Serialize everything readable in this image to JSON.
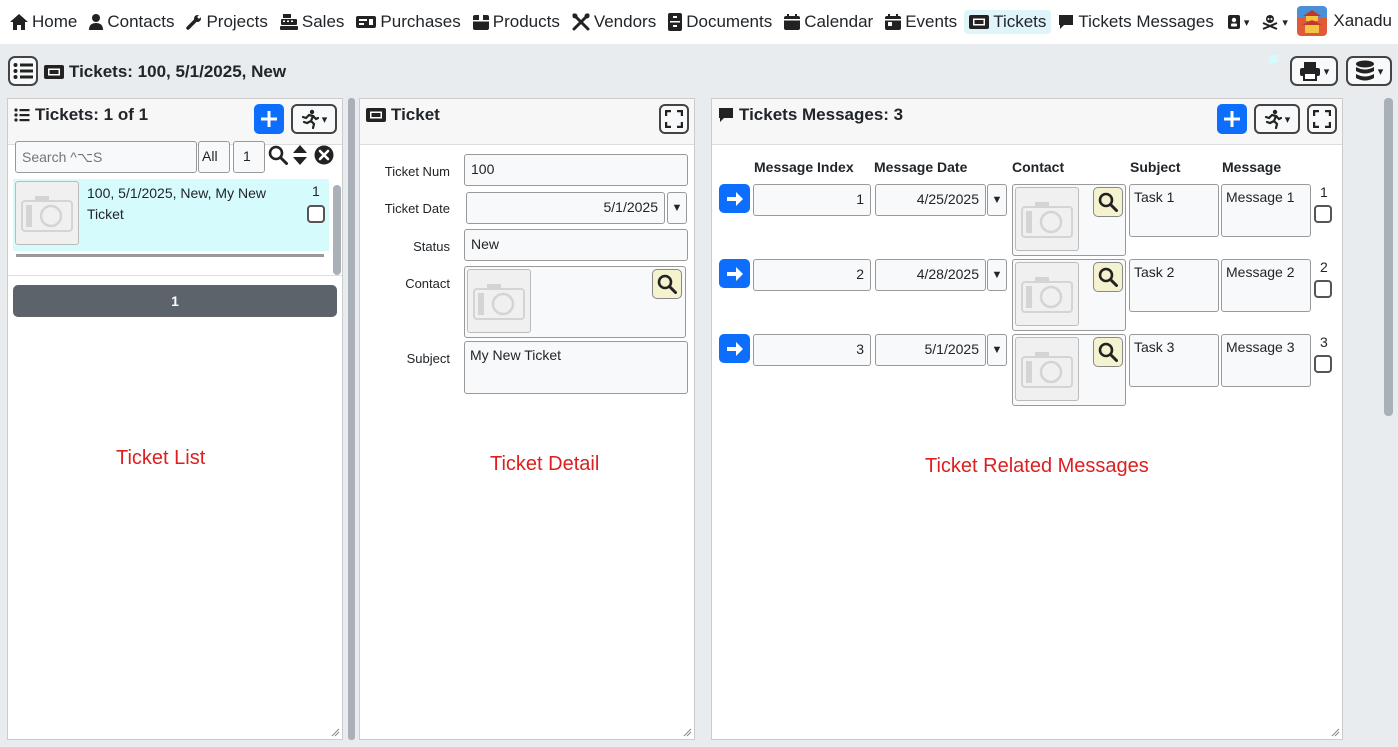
{
  "nav": {
    "items": [
      {
        "label": "Home",
        "icon": "home-icon",
        "name": "nav-home"
      },
      {
        "label": "Contacts",
        "icon": "user-icon",
        "name": "nav-contacts"
      },
      {
        "label": "Projects",
        "icon": "wrench-icon",
        "name": "nav-projects"
      },
      {
        "label": "Sales",
        "icon": "cash-register-icon",
        "name": "nav-sales"
      },
      {
        "label": "Purchases",
        "icon": "money-check-icon",
        "name": "nav-purchases"
      },
      {
        "label": "Products",
        "icon": "box-icon",
        "name": "nav-products"
      },
      {
        "label": "Vendors",
        "icon": "tools-icon",
        "name": "nav-vendors"
      },
      {
        "label": "Documents",
        "icon": "file-cabinet-icon",
        "name": "nav-documents"
      },
      {
        "label": "Calendar",
        "icon": "calendar-icon",
        "name": "nav-calendar"
      },
      {
        "label": "Events",
        "icon": "calendar-day-icon",
        "name": "nav-events"
      },
      {
        "label": "Tickets",
        "icon": "ticket-icon",
        "name": "nav-tickets"
      },
      {
        "label": "Tickets Messages",
        "icon": "comment-icon",
        "name": "nav-tickets-messages"
      }
    ],
    "active": "Tickets",
    "user": "Xanadu"
  },
  "page": {
    "title": "Tickets: 100, 5/1/2025, New"
  },
  "list_panel": {
    "title": "Tickets: 1 of 1",
    "search_placeholder": "Search ^⌥S",
    "filter_all": "All",
    "page_size": "1",
    "rows": [
      {
        "text": "100, 5/1/2025, New, My New Ticket",
        "index": "1"
      }
    ],
    "pager": "1",
    "caption": "Ticket List"
  },
  "detail_panel": {
    "title": "Ticket",
    "labels": {
      "num": "Ticket Num",
      "date": "Ticket Date",
      "status": "Status",
      "contact": "Contact",
      "subject": "Subject"
    },
    "values": {
      "num": "100",
      "date": "5/1/2025",
      "status": "New",
      "subject": "My New Ticket"
    },
    "caption": "Ticket Detail"
  },
  "messages_panel": {
    "title": "Tickets Messages: 3",
    "columns": [
      "Message Index",
      "Message Date",
      "Contact",
      "Subject",
      "Message"
    ],
    "rows": [
      {
        "index": "1",
        "date": "4/25/2025",
        "subject": "Task 1",
        "message": "Message 1",
        "num": "1"
      },
      {
        "index": "2",
        "date": "4/28/2025",
        "subject": "Task 2",
        "message": "Message 2",
        "num": "2"
      },
      {
        "index": "3",
        "date": "5/1/2025",
        "subject": "Task 3",
        "message": "Message 3",
        "num": "3"
      }
    ],
    "caption": "Ticket Related Messages"
  },
  "colors": {
    "accent": "#0d6efd",
    "active_nav": "#dff5fa",
    "selected_row": "#d6fbfd",
    "caption": "#dd1f1f",
    "pager": "#5c636a"
  }
}
